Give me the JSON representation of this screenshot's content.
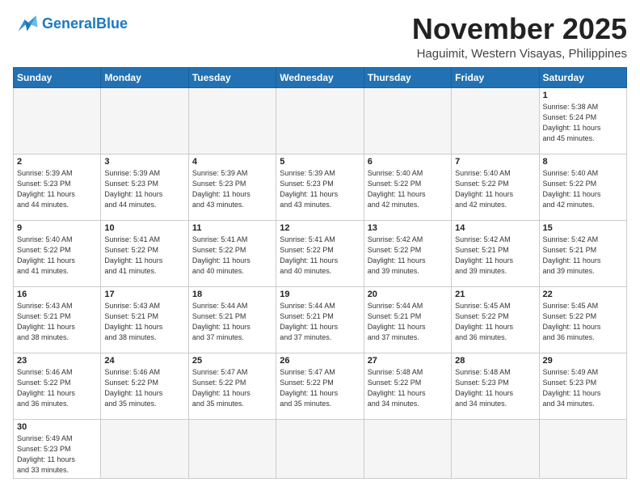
{
  "header": {
    "logo_general": "General",
    "logo_blue": "Blue",
    "month_title": "November 2025",
    "location": "Haguimit, Western Visayas, Philippines"
  },
  "weekdays": [
    "Sunday",
    "Monday",
    "Tuesday",
    "Wednesday",
    "Thursday",
    "Friday",
    "Saturday"
  ],
  "weeks": [
    [
      {
        "day": "",
        "info": ""
      },
      {
        "day": "",
        "info": ""
      },
      {
        "day": "",
        "info": ""
      },
      {
        "day": "",
        "info": ""
      },
      {
        "day": "",
        "info": ""
      },
      {
        "day": "",
        "info": ""
      },
      {
        "day": "1",
        "info": "Sunrise: 5:38 AM\nSunset: 5:24 PM\nDaylight: 11 hours\nand 45 minutes."
      }
    ],
    [
      {
        "day": "2",
        "info": "Sunrise: 5:39 AM\nSunset: 5:23 PM\nDaylight: 11 hours\nand 44 minutes."
      },
      {
        "day": "3",
        "info": "Sunrise: 5:39 AM\nSunset: 5:23 PM\nDaylight: 11 hours\nand 44 minutes."
      },
      {
        "day": "4",
        "info": "Sunrise: 5:39 AM\nSunset: 5:23 PM\nDaylight: 11 hours\nand 43 minutes."
      },
      {
        "day": "5",
        "info": "Sunrise: 5:39 AM\nSunset: 5:23 PM\nDaylight: 11 hours\nand 43 minutes."
      },
      {
        "day": "6",
        "info": "Sunrise: 5:40 AM\nSunset: 5:22 PM\nDaylight: 11 hours\nand 42 minutes."
      },
      {
        "day": "7",
        "info": "Sunrise: 5:40 AM\nSunset: 5:22 PM\nDaylight: 11 hours\nand 42 minutes."
      },
      {
        "day": "8",
        "info": "Sunrise: 5:40 AM\nSunset: 5:22 PM\nDaylight: 11 hours\nand 42 minutes."
      }
    ],
    [
      {
        "day": "9",
        "info": "Sunrise: 5:40 AM\nSunset: 5:22 PM\nDaylight: 11 hours\nand 41 minutes."
      },
      {
        "day": "10",
        "info": "Sunrise: 5:41 AM\nSunset: 5:22 PM\nDaylight: 11 hours\nand 41 minutes."
      },
      {
        "day": "11",
        "info": "Sunrise: 5:41 AM\nSunset: 5:22 PM\nDaylight: 11 hours\nand 40 minutes."
      },
      {
        "day": "12",
        "info": "Sunrise: 5:41 AM\nSunset: 5:22 PM\nDaylight: 11 hours\nand 40 minutes."
      },
      {
        "day": "13",
        "info": "Sunrise: 5:42 AM\nSunset: 5:22 PM\nDaylight: 11 hours\nand 39 minutes."
      },
      {
        "day": "14",
        "info": "Sunrise: 5:42 AM\nSunset: 5:21 PM\nDaylight: 11 hours\nand 39 minutes."
      },
      {
        "day": "15",
        "info": "Sunrise: 5:42 AM\nSunset: 5:21 PM\nDaylight: 11 hours\nand 39 minutes."
      }
    ],
    [
      {
        "day": "16",
        "info": "Sunrise: 5:43 AM\nSunset: 5:21 PM\nDaylight: 11 hours\nand 38 minutes."
      },
      {
        "day": "17",
        "info": "Sunrise: 5:43 AM\nSunset: 5:21 PM\nDaylight: 11 hours\nand 38 minutes."
      },
      {
        "day": "18",
        "info": "Sunrise: 5:44 AM\nSunset: 5:21 PM\nDaylight: 11 hours\nand 37 minutes."
      },
      {
        "day": "19",
        "info": "Sunrise: 5:44 AM\nSunset: 5:21 PM\nDaylight: 11 hours\nand 37 minutes."
      },
      {
        "day": "20",
        "info": "Sunrise: 5:44 AM\nSunset: 5:21 PM\nDaylight: 11 hours\nand 37 minutes."
      },
      {
        "day": "21",
        "info": "Sunrise: 5:45 AM\nSunset: 5:22 PM\nDaylight: 11 hours\nand 36 minutes."
      },
      {
        "day": "22",
        "info": "Sunrise: 5:45 AM\nSunset: 5:22 PM\nDaylight: 11 hours\nand 36 minutes."
      }
    ],
    [
      {
        "day": "23",
        "info": "Sunrise: 5:46 AM\nSunset: 5:22 PM\nDaylight: 11 hours\nand 36 minutes."
      },
      {
        "day": "24",
        "info": "Sunrise: 5:46 AM\nSunset: 5:22 PM\nDaylight: 11 hours\nand 35 minutes."
      },
      {
        "day": "25",
        "info": "Sunrise: 5:47 AM\nSunset: 5:22 PM\nDaylight: 11 hours\nand 35 minutes."
      },
      {
        "day": "26",
        "info": "Sunrise: 5:47 AM\nSunset: 5:22 PM\nDaylight: 11 hours\nand 35 minutes."
      },
      {
        "day": "27",
        "info": "Sunrise: 5:48 AM\nSunset: 5:22 PM\nDaylight: 11 hours\nand 34 minutes."
      },
      {
        "day": "28",
        "info": "Sunrise: 5:48 AM\nSunset: 5:23 PM\nDaylight: 11 hours\nand 34 minutes."
      },
      {
        "day": "29",
        "info": "Sunrise: 5:49 AM\nSunset: 5:23 PM\nDaylight: 11 hours\nand 34 minutes."
      }
    ],
    [
      {
        "day": "30",
        "info": "Sunrise: 5:49 AM\nSunset: 5:23 PM\nDaylight: 11 hours\nand 33 minutes."
      },
      {
        "day": "",
        "info": ""
      },
      {
        "day": "",
        "info": ""
      },
      {
        "day": "",
        "info": ""
      },
      {
        "day": "",
        "info": ""
      },
      {
        "day": "",
        "info": ""
      },
      {
        "day": "",
        "info": ""
      }
    ]
  ]
}
